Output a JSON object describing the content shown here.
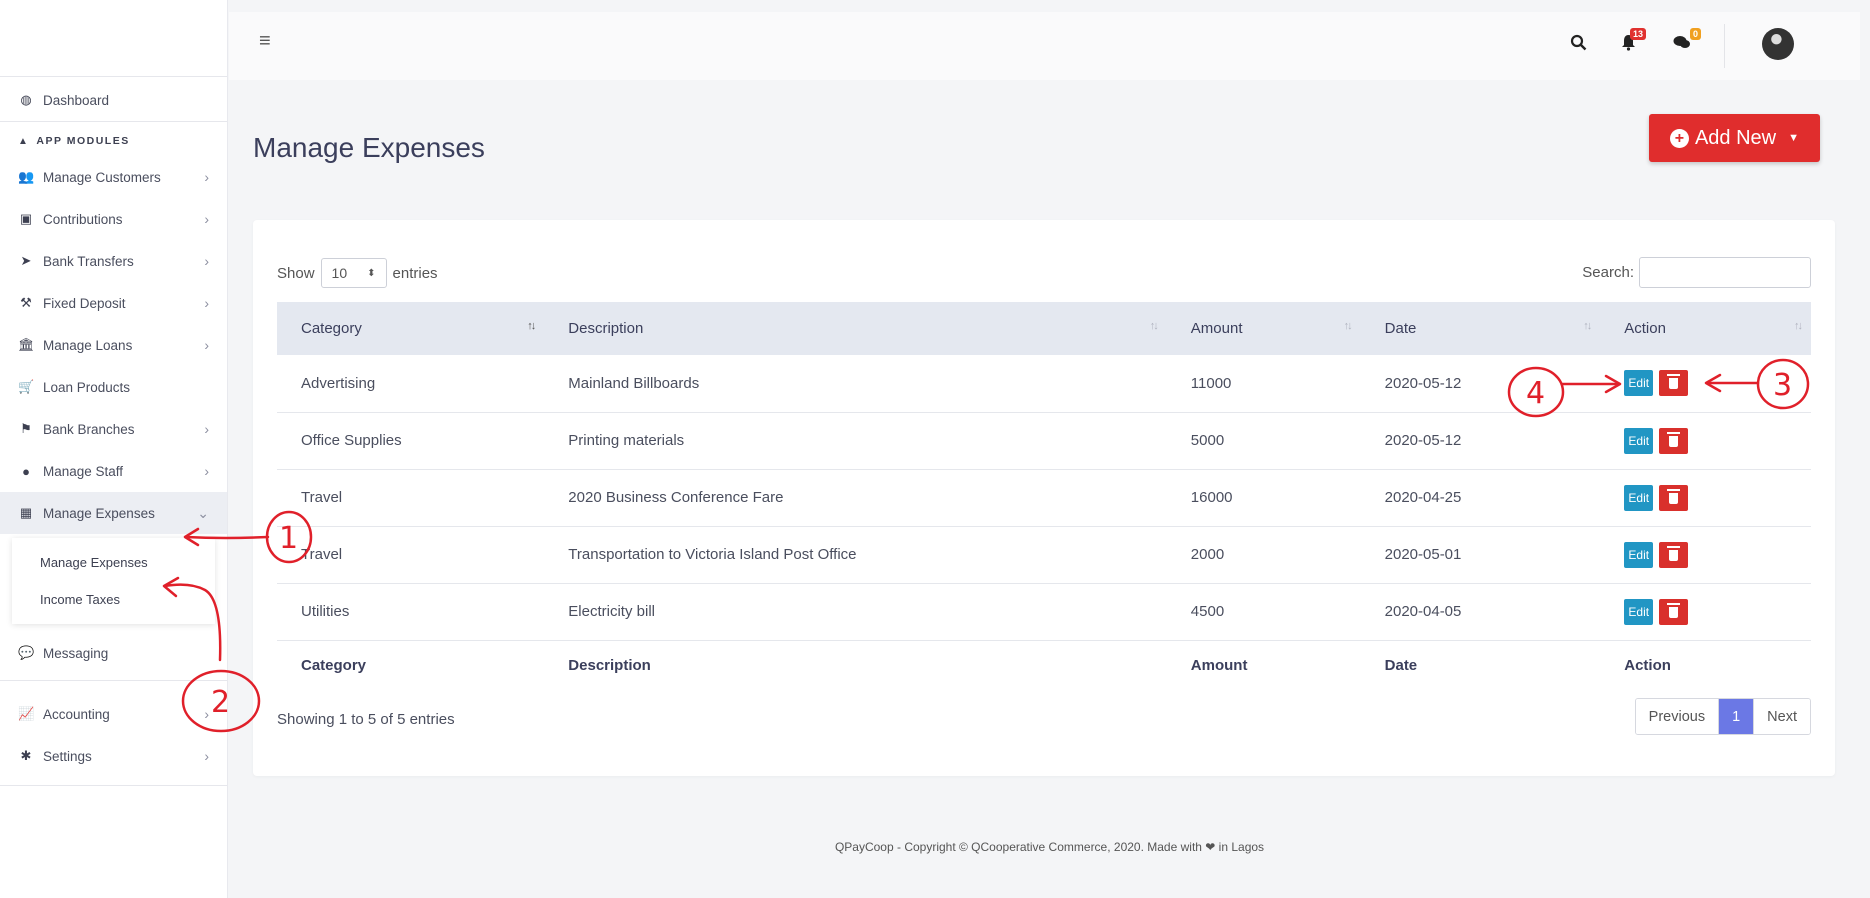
{
  "sidebar": {
    "dashboard": "Dashboard",
    "modules_header": "APP MODULES",
    "items": [
      {
        "label": "Manage Customers",
        "icon": "users-icon"
      },
      {
        "label": "Contributions",
        "icon": "money-icon"
      },
      {
        "label": "Bank Transfers",
        "icon": "paper-plane-icon"
      },
      {
        "label": "Fixed Deposit",
        "icon": "gavel-icon"
      },
      {
        "label": "Manage Loans",
        "icon": "bank-icon"
      },
      {
        "label": "Loan Products",
        "icon": "cart-icon"
      },
      {
        "label": "Bank Branches",
        "icon": "flag-icon"
      },
      {
        "label": "Manage Staff",
        "icon": "user-icon"
      },
      {
        "label": "Manage Expenses",
        "icon": "calculator-icon"
      }
    ],
    "expenses_sub": [
      "Manage Expenses",
      "Income Taxes"
    ],
    "messaging": "Messaging",
    "accounting": "Accounting",
    "settings": "Settings"
  },
  "topbar": {
    "notifications_count": "13",
    "messages_count": "0",
    "badge_colors": {
      "notifications": "#e0312f",
      "messages": "#f0a020"
    }
  },
  "page": {
    "title": "Manage Expenses",
    "add_new": "Add New"
  },
  "table_controls": {
    "show": "Show",
    "entries_value": "10",
    "entries": "entries",
    "search": "Search:"
  },
  "table": {
    "headers": [
      "Category",
      "Description",
      "Amount",
      "Date",
      "Action"
    ],
    "rows": [
      {
        "category": "Advertising",
        "description": "Mainland Billboards",
        "amount": "11000",
        "date": "2020-05-12"
      },
      {
        "category": "Office Supplies",
        "description": "Printing materials",
        "amount": "5000",
        "date": "2020-05-12"
      },
      {
        "category": "Travel",
        "description": "2020 Business Conference Fare",
        "amount": "16000",
        "date": "2020-04-25"
      },
      {
        "category": "Travel",
        "description": "Transportation to Victoria Island Post Office",
        "amount": "2000",
        "date": "2020-05-01"
      },
      {
        "category": "Utilities",
        "description": "Electricity bill",
        "amount": "4500",
        "date": "2020-04-05"
      }
    ],
    "edit_label": "Edit"
  },
  "pagination": {
    "info": "Showing 1 to 5 of 5 entries",
    "previous": "Previous",
    "page": "1",
    "next": "Next"
  },
  "footer": {
    "text": "QPayCoop - Copyright © QCooperative Commerce, 2020. Made with ❤ in Lagos"
  },
  "annotations": {
    "marks": [
      "1",
      "2",
      "3",
      "4"
    ],
    "color": "#e0202a"
  }
}
